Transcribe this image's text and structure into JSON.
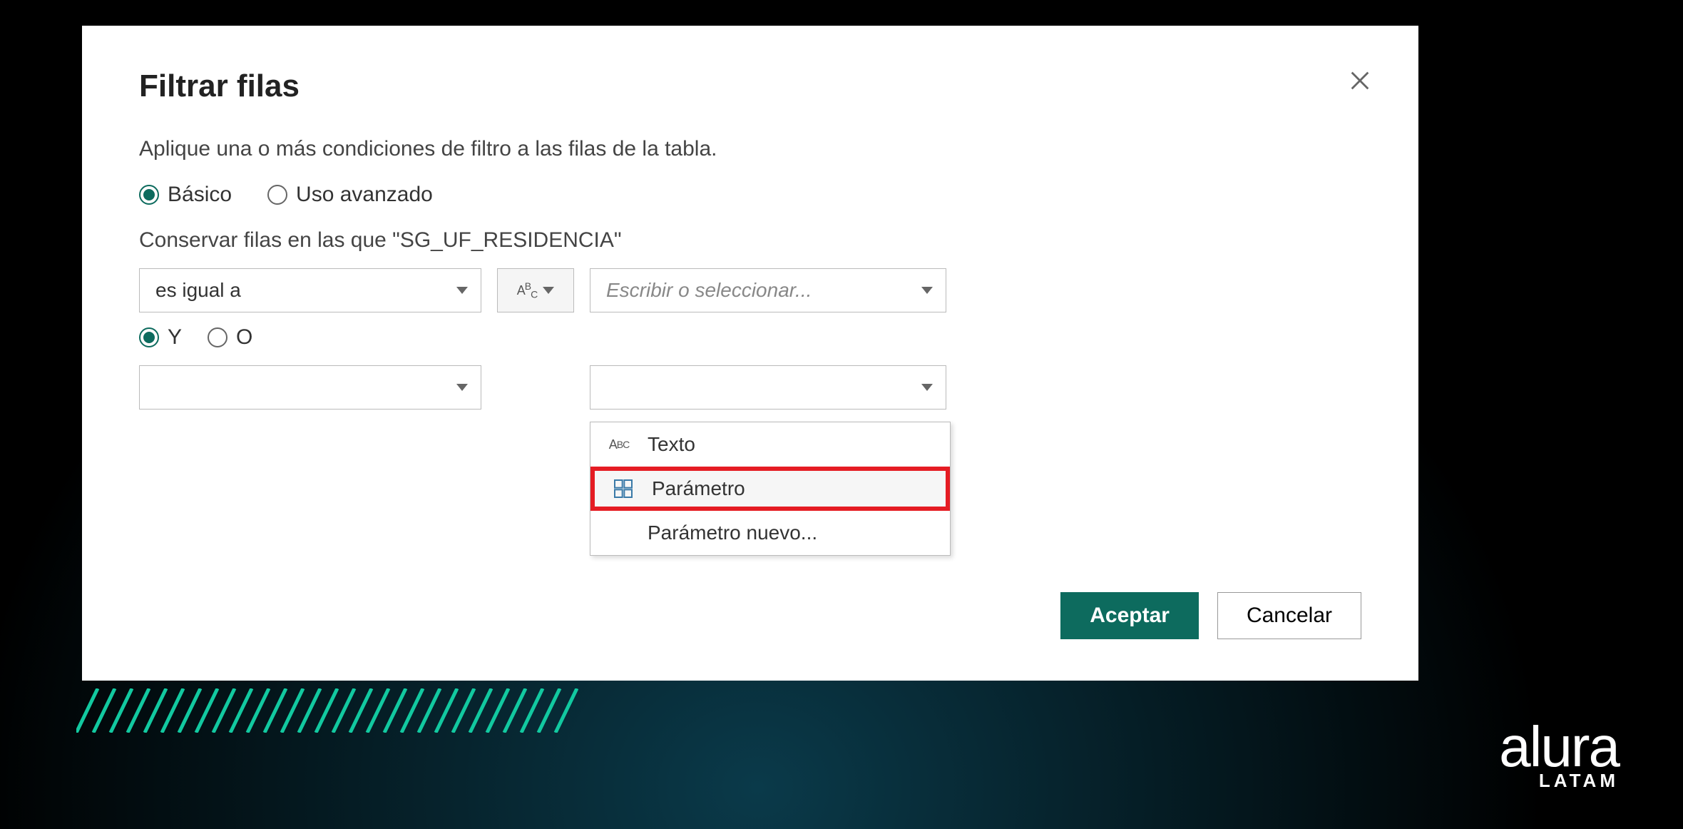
{
  "dialog": {
    "title": "Filtrar filas",
    "subtitle": "Aplique una o más condiciones de filtro a las filas de la tabla.",
    "mode": {
      "basic": "Básico",
      "advanced": "Uso avanzado"
    },
    "keep_rows_label": "Conservar filas en las que \"SG_UF_RESIDENCIA\"",
    "condition1": {
      "operator": "es igual a",
      "value_placeholder": "Escribir o seleccionar..."
    },
    "logic": {
      "and": "Y",
      "or": "O"
    },
    "type_menu": {
      "text": "Texto",
      "parameter": "Parámetro",
      "new_parameter": "Parámetro nuevo..."
    },
    "buttons": {
      "accept": "Aceptar",
      "cancel": "Cancelar"
    }
  },
  "brand": {
    "name": "alura",
    "region": "LATAM"
  }
}
